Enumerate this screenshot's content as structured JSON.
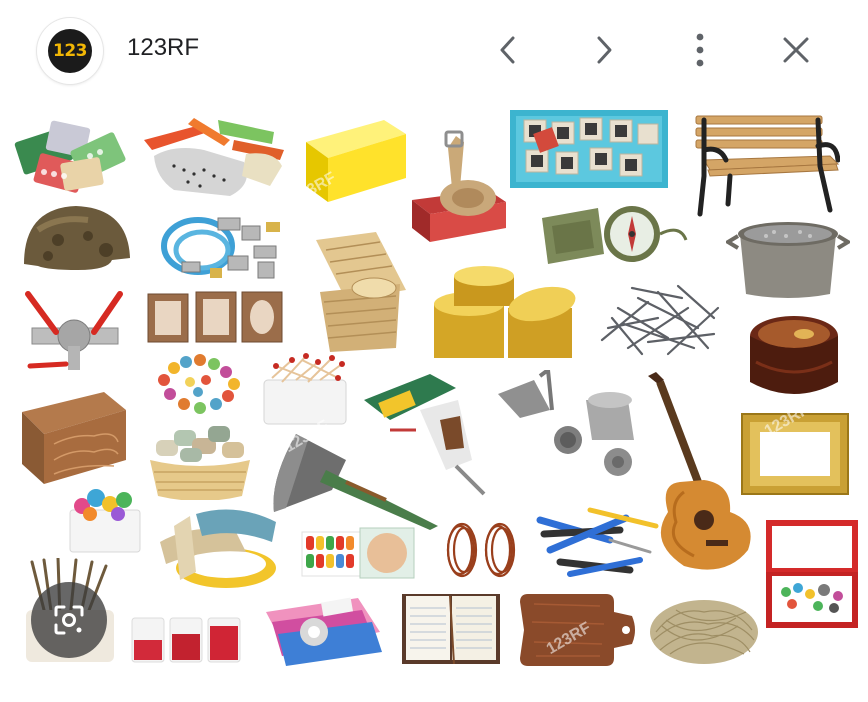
{
  "header": {
    "logo_text": "123",
    "site_title": "123RF",
    "icons": [
      "chevron-left-icon",
      "chevron-right-icon",
      "more-vert-icon",
      "close-icon"
    ]
  },
  "colors": {
    "logo_bg": "#1b1b1b",
    "logo_text": "#f2b705",
    "title": "#202124",
    "icon": "#5f6368"
  },
  "lens": {
    "icon": "lens-search-icon"
  },
  "grid": {
    "items": [
      "pills",
      "gloves-and-tools",
      "yellow-sponge",
      "belt-in-box",
      "photo-slides-box",
      "park-bench",
      "rusty-helmet",
      "hoses-and-fittings",
      "compass",
      "valve-with-red-handles",
      "wooden-frames",
      "wicker-baskets",
      "gold-boxes",
      "nails-pile",
      "wooden-jewelry-box",
      "bead-necklaces",
      "matches-in-bowl",
      "electric-drill-open",
      "meat-grinder",
      "acoustic-guitar",
      "carved-wooden-box",
      "yarn-basket",
      "axe",
      "gold-picture-frame",
      "plastic-toys-box",
      "rolled-ribbons",
      "colored-crayons",
      "copper-wire-coils",
      "screwdrivers",
      "red-treasure-box",
      "cutlery-pot",
      "glasses-red-liquid",
      "sponges-and-tape",
      "open-notebook",
      "cutting-board",
      "twine-bundle"
    ]
  }
}
